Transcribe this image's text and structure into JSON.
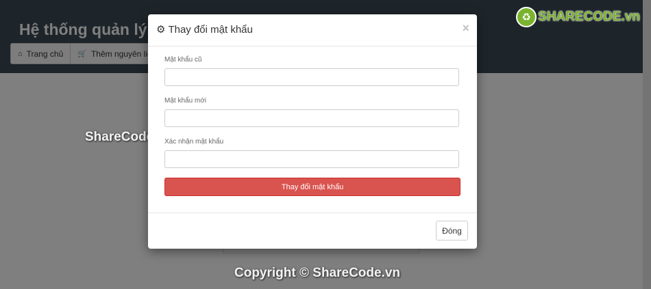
{
  "header": {
    "title": "Hệ thống quản lý k",
    "nav": [
      {
        "label": "Trang chủ",
        "icon": "home-icon"
      },
      {
        "label": "Thêm nguyên liệu",
        "icon": "cart-icon"
      }
    ]
  },
  "watermarks": {
    "middle": "ShareCode.vn",
    "copyright": "Copyright © ShareCode.vn",
    "logo": "SHARECODE.vn"
  },
  "modal": {
    "title": "Thay đổi mật khẩu",
    "title_icon": "gear-icon",
    "close_symbol": "×",
    "fields": [
      {
        "label": "Mật khẩu cũ",
        "value": "",
        "placeholder": ""
      },
      {
        "label": "Mật khẩu mới",
        "value": "",
        "placeholder": ""
      },
      {
        "label": "Xác nhận mật khẩu",
        "value": "",
        "placeholder": ""
      }
    ],
    "submit_label": "Thay đổi mật khẩu",
    "close_label": "Đóng"
  },
  "colors": {
    "header_bg": "#3c4a54",
    "submit_bg": "#d9534f",
    "logo_green": "#7ab32e"
  }
}
